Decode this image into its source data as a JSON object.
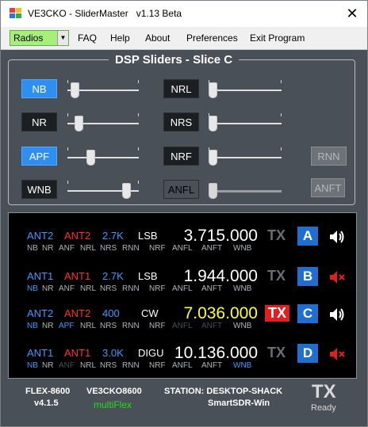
{
  "window": {
    "app_name": "VE3CKO - SliderMaster",
    "version": "v1.13 Beta",
    "close_glyph": "✕"
  },
  "menu": {
    "radios_value": "Radios",
    "items": [
      "FAQ",
      "Help",
      "About",
      "Preferences",
      "Exit Program"
    ]
  },
  "dsp": {
    "title": "DSP Sliders - Slice C",
    "left_controls": [
      {
        "label": "NB",
        "state": "on",
        "level": 0.05
      },
      {
        "label": "NR",
        "state": "off",
        "level": 0.12
      },
      {
        "label": "APF",
        "state": "on",
        "level": 0.3
      },
      {
        "label": "WNB",
        "state": "off",
        "level": 0.87
      }
    ],
    "right_controls": [
      {
        "label": "NRL",
        "state": "off",
        "level": 0.0
      },
      {
        "label": "NRS",
        "state": "off",
        "level": 0.0
      },
      {
        "label": "NRF",
        "state": "off",
        "level": 0.0
      },
      {
        "label": "ANFL",
        "state": "disabled",
        "level": 0.0
      }
    ],
    "extra_buttons": [
      "RNN",
      "ANFT"
    ]
  },
  "slices": [
    {
      "letter": "A",
      "ant_rx": "ANT2",
      "ant_tx": "ANT2",
      "bw": "2.7K",
      "mode": "LSB",
      "freq": "3.715.000",
      "tx_label": "TX",
      "tx_active": false,
      "freq_color": "#ffffff",
      "muted": false,
      "flags_left": [
        "NB",
        "NR",
        "ANF",
        "NRL",
        "NRS",
        "RNN"
      ],
      "flags_right": [
        "NRF",
        "ANFL",
        "ANFT",
        "WNB"
      ],
      "flag_colors_left": [
        "#b0b4b8",
        "#b0b4b8",
        "#b0b4b8",
        "#b0b4b8",
        "#b0b4b8",
        "#b0b4b8"
      ],
      "flag_colors_right": [
        "#b0b4b8",
        "#b0b4b8",
        "#b0b4b8",
        "#b0b4b8"
      ]
    },
    {
      "letter": "B",
      "ant_rx": "ANT1",
      "ant_tx": "ANT1",
      "bw": "2.7K",
      "mode": "LSB",
      "freq": "1.944.000",
      "tx_label": "TX",
      "tx_active": false,
      "freq_color": "#ffffff",
      "muted": true,
      "flags_left": [
        "NB",
        "NR",
        "ANF",
        "NRL",
        "NRS",
        "RNN"
      ],
      "flags_right": [
        "NRF",
        "ANFL",
        "ANFT",
        "WNB"
      ],
      "flag_colors_left": [
        "#3d9bff",
        "#b0b4b8",
        "#b0b4b8",
        "#b0b4b8",
        "#b0b4b8",
        "#b0b4b8"
      ],
      "flag_colors_right": [
        "#b0b4b8",
        "#b0b4b8",
        "#b0b4b8",
        "#b0b4b8"
      ]
    },
    {
      "letter": "C",
      "ant_rx": "ANT2",
      "ant_tx": "ANT2",
      "bw": "400",
      "mode": "CW",
      "freq": "7.036.000",
      "tx_label": "TX",
      "tx_active": true,
      "freq_color": "#ffff33",
      "muted": false,
      "flags_left": [
        "NB",
        "NR",
        "APF",
        "NRL",
        "NRS",
        "RNN"
      ],
      "flags_right": [
        "NRF",
        "ANFL",
        "ANFT",
        "WNB"
      ],
      "flag_colors_left": [
        "#3d9bff",
        "#b0b4b8",
        "#3d9bff",
        "#b0b4b8",
        "#b0b4b8",
        "#b0b4b8"
      ],
      "flag_colors_right": [
        "#b0b4b8",
        "#4a4e52",
        "#4a4e52",
        "#b0b4b8"
      ]
    },
    {
      "letter": "D",
      "ant_rx": "ANT1",
      "ant_tx": "ANT1",
      "bw": "3.0K",
      "mode": "DIGU",
      "freq": "10.136.000",
      "tx_label": "TX",
      "tx_active": false,
      "freq_color": "#ffffff",
      "muted": true,
      "flags_left": [
        "NB",
        "NR",
        "ANF",
        "NRL",
        "NRS",
        "RNN"
      ],
      "flags_right": [
        "NRF",
        "ANFL",
        "ANFT",
        "WNB"
      ],
      "flag_colors_left": [
        "#3d9bff",
        "#b0b4b8",
        "#4a4e52",
        "#b0b4b8",
        "#b0b4b8",
        "#b0b4b8"
      ],
      "flag_colors_right": [
        "#b0b4b8",
        "#b0b4b8",
        "#b0b4b8",
        "#3d9bff"
      ]
    }
  ],
  "footer": {
    "radio_model": "FLEX-8600",
    "radio_version": "v4.1.5",
    "callsign_radio": "VE3CKO8600",
    "multiflex": "multiFlex",
    "station": "STATION: DESKTOP-SHACK",
    "client": "SmartSDR-Win",
    "tx_label": "TX",
    "tx_status": "Ready"
  },
  "colors": {
    "blue_ant": "#3d9bff",
    "red_ant": "#ff3030",
    "tx_active_bg": "#e02020",
    "letter_bg": "#1e6fd0",
    "multiflex_green": "#22dd22"
  }
}
